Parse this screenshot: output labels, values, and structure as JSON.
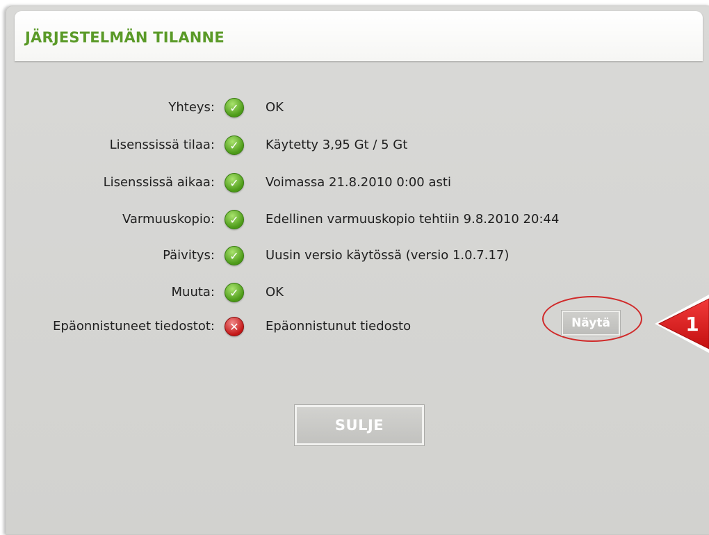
{
  "dialog": {
    "title": "JÄRJESTELMÄN TILANNE"
  },
  "rows": [
    {
      "label": "Yhteys:",
      "status": "ok",
      "status_icon": "check-icon",
      "value": "OK"
    },
    {
      "label": "Lisenssissä tilaa:",
      "status": "ok",
      "status_icon": "check-icon",
      "value": "Käytetty 3,95 Gt / 5 Gt"
    },
    {
      "label": "Lisenssissä aikaa:",
      "status": "ok",
      "status_icon": "check-icon",
      "value": "Voimassa 21.8.2010 0:00 asti"
    },
    {
      "label": "Varmuuskopio:",
      "status": "ok",
      "status_icon": "check-icon",
      "value": "Edellinen varmuuskopio tehtiin 9.8.2010 20:44"
    },
    {
      "label": "Päivitys:",
      "status": "ok",
      "status_icon": "check-icon",
      "value": "Uusin versio käytössä (versio 1.0.7.17)"
    },
    {
      "label": "Muuta:",
      "status": "ok",
      "status_icon": "check-icon",
      "value": "OK"
    },
    {
      "label": "Epäonnistuneet tiedostot:",
      "status": "fail",
      "status_icon": "cross-icon",
      "value": "Epäonnistunut tiedosto"
    }
  ],
  "actions": {
    "show_label": "Näytä",
    "close_label": "SULJE"
  },
  "callout": {
    "number": "1",
    "color": "#e01b1b"
  },
  "colors": {
    "title": "#5a9a28",
    "ok": "#4c9a18",
    "fail": "#c41818"
  }
}
